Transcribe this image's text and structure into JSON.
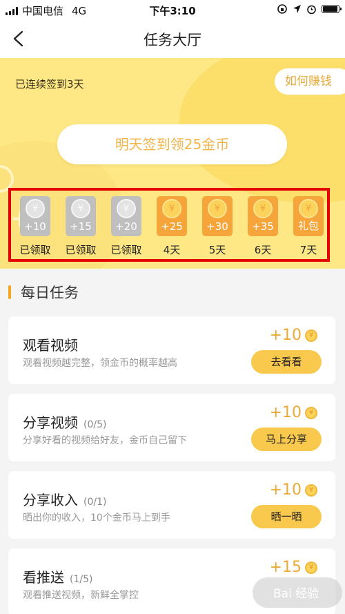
{
  "status_bar": {
    "carrier": "中国电信",
    "network": "4G",
    "time": "下午3:10",
    "battery_level": 0.95
  },
  "nav": {
    "title": "任务大厅"
  },
  "hero": {
    "streak_text": "已连续签到3天",
    "how_earn_label": "如何赚钱",
    "sign_button_label": "明天签到领25金币",
    "days": [
      {
        "coin": "+10",
        "label": "已领取",
        "claimed": true
      },
      {
        "coin": "+15",
        "label": "已领取",
        "claimed": true
      },
      {
        "coin": "+20",
        "label": "已领取",
        "claimed": true
      },
      {
        "coin": "+25",
        "label": "4天",
        "claimed": false
      },
      {
        "coin": "+30",
        "label": "5天",
        "claimed": false
      },
      {
        "coin": "+35",
        "label": "6天",
        "claimed": false
      },
      {
        "coin": "礼包",
        "label": "7天",
        "claimed": false
      }
    ],
    "coin_symbol": "¥"
  },
  "section": {
    "title": "每日任务"
  },
  "tasks": [
    {
      "title": "观看视频",
      "count": "",
      "desc": "观看视频越完整，领金币的概率越高",
      "reward": "+10",
      "action": "去看看"
    },
    {
      "title": "分享视频",
      "count": "(0/5)",
      "desc": "分享好看的视频给好友，金币自己留下",
      "reward": "+10",
      "action": "马上分享"
    },
    {
      "title": "分享收入",
      "count": "(0/1)",
      "desc": "晒出你的收入，10个金币马上到手",
      "reward": "+10",
      "action": "晒一晒"
    },
    {
      "title": "看推送",
      "count": "(1/5)",
      "desc": "观看推送视频，新鲜全掌控",
      "reward": "+15",
      "action": ""
    }
  ],
  "watermark": "Bai 经验",
  "colors": {
    "accent": "#f9c94d",
    "hero_bg": "#fde885",
    "highlight_border": "#e50000"
  }
}
